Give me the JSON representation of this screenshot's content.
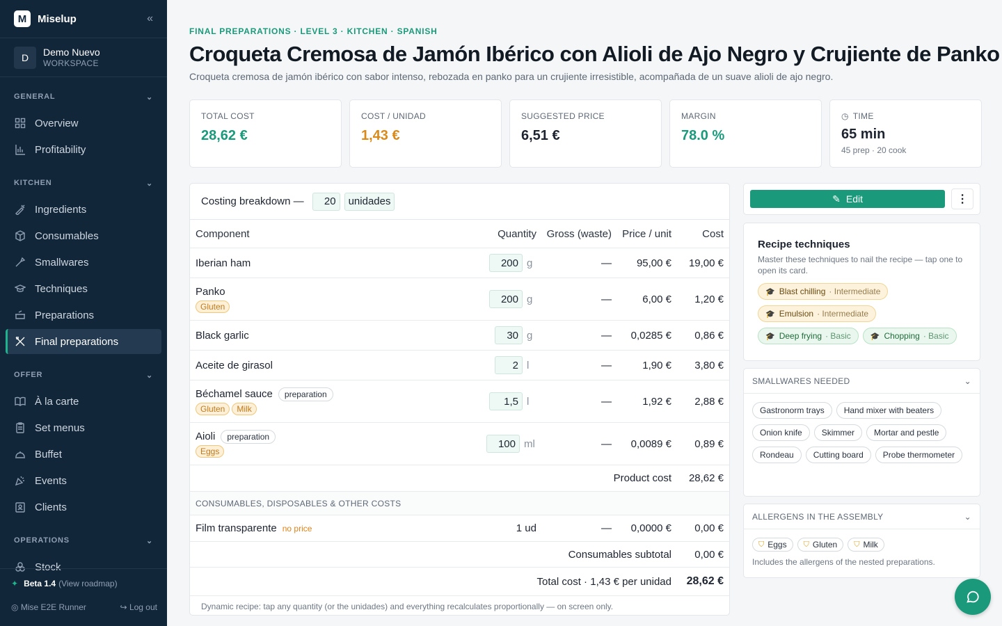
{
  "app": {
    "name": "Miselup",
    "logo_letter": "M"
  },
  "workspace": {
    "avatar": "D",
    "name": "Demo Nuevo",
    "label": "WORKSPACE"
  },
  "nav": {
    "general": {
      "title": "GENERAL",
      "items": [
        {
          "label": "Overview",
          "icon": "grid-icon"
        },
        {
          "label": "Profitability",
          "icon": "bar-chart-icon"
        }
      ]
    },
    "kitchen": {
      "title": "KITCHEN",
      "items": [
        {
          "label": "Ingredients",
          "icon": "carrot-icon"
        },
        {
          "label": "Consumables",
          "icon": "box-icon"
        },
        {
          "label": "Smallwares",
          "icon": "tool-icon"
        },
        {
          "label": "Techniques",
          "icon": "graduation-cap-icon"
        },
        {
          "label": "Preparations",
          "icon": "pot-icon"
        },
        {
          "label": "Final preparations",
          "icon": "utensils-icon",
          "active": true
        }
      ]
    },
    "offer": {
      "title": "OFFER",
      "items": [
        {
          "label": "À la carte",
          "icon": "book-icon"
        },
        {
          "label": "Set menus",
          "icon": "clipboard-icon"
        },
        {
          "label": "Buffet",
          "icon": "cloche-icon"
        },
        {
          "label": "Events",
          "icon": "party-icon"
        },
        {
          "label": "Clients",
          "icon": "id-card-icon"
        }
      ]
    },
    "operations": {
      "title": "OPERATIONS",
      "items": [
        {
          "label": "Stock",
          "icon": "boxes-icon"
        }
      ]
    }
  },
  "sidebar_footer": {
    "version": "Beta 1.4",
    "roadmap": "(View roadmap)",
    "user": "Mise E2E Runner",
    "logout": "Log out"
  },
  "recipe": {
    "eyebrow": "FINAL PREPARATIONS  · LEVEL 3 · KITCHEN · SPANISH",
    "title": "Croqueta Cremosa de Jamón Ibérico con Alioli de Ajo Negro y Crujiente de Panko",
    "description": "Croqueta cremosa de jamón ibérico con sabor intenso, rebozada en panko para un crujiente irresistible, acompañada de un suave alioli de ajo negro."
  },
  "stats": {
    "total_cost": {
      "label": "TOTAL COST",
      "value": "28,62 €",
      "color": "#1a9a7b"
    },
    "cost_unit": {
      "label": "COST / UNIDAD",
      "value": "1,43 €",
      "color": "#d98a1a"
    },
    "suggested_price": {
      "label": "SUGGESTED PRICE",
      "value": "6,51 €",
      "color": "#1d2430"
    },
    "margin": {
      "label": "MARGIN",
      "value": "78.0 %",
      "color": "#1a9a7b"
    },
    "time": {
      "label": "TIME",
      "value": "65 min",
      "sub": "45 prep · 20 cook"
    }
  },
  "costing": {
    "heading": "Costing breakdown —",
    "yield_qty": "20",
    "yield_unit": "unidades",
    "columns": {
      "component": "Component",
      "quantity": "Quantity",
      "gross": "Gross (waste)",
      "price": "Price / unit",
      "cost": "Cost"
    },
    "rows": [
      {
        "name": "Iberian ham",
        "qty": "200",
        "unit": "g",
        "gross": "—",
        "price": "95,00 €",
        "cost": "19,00 €"
      },
      {
        "name": "Panko",
        "allergens": [
          "Gluten"
        ],
        "qty": "200",
        "unit": "g",
        "gross": "—",
        "price": "6,00 €",
        "cost": "1,20 €"
      },
      {
        "name": "Black garlic",
        "qty": "30",
        "unit": "g",
        "gross": "—",
        "price": "0,0285 €",
        "cost": "0,86 €"
      },
      {
        "name": "Aceite de girasol",
        "qty": "2",
        "unit": "l",
        "gross": "—",
        "price": "1,90 €",
        "cost": "3,80 €"
      },
      {
        "name": "Béchamel sauce",
        "tag": "preparation",
        "allergens": [
          "Gluten",
          "Milk"
        ],
        "qty": "1,5",
        "unit": "l",
        "gross": "—",
        "price": "1,92 €",
        "cost": "2,88 €"
      },
      {
        "name": "Aioli",
        "tag": "preparation",
        "allergens": [
          "Eggs"
        ],
        "qty": "100",
        "unit": "ml",
        "gross": "—",
        "price": "0,0089 €",
        "cost": "0,89 €"
      }
    ],
    "product_cost_label": "Product cost",
    "product_cost": "28,62 €",
    "consumables_heading": "CONSUMABLES, DISPOSABLES & OTHER COSTS",
    "consumables": [
      {
        "name": "Film transparente",
        "flag": "no price",
        "qty": "1 ud",
        "gross": "—",
        "price": "0,0000 €",
        "cost": "0,00 €"
      }
    ],
    "consumables_subtotal_label": "Consumables subtotal",
    "consumables_subtotal": "0,00 €",
    "total_label": "Total cost · 1,43 € per unidad",
    "total": "28,62 €",
    "note": "Dynamic recipe: tap any quantity (or the unidades) and everything recalculates proportionally — on screen only."
  },
  "actions": {
    "edit": "Edit",
    "more": "⋮"
  },
  "techniques": {
    "title": "Recipe techniques",
    "description": "Master these techniques to nail the recipe — tap one to open its card.",
    "items": [
      {
        "name": "Blast chilling",
        "level": "· Intermediate",
        "kind": "inter"
      },
      {
        "name": "Emulsion",
        "level": "· Intermediate",
        "kind": "inter"
      },
      {
        "name": "Deep frying",
        "level": "· Basic",
        "kind": "basic"
      },
      {
        "name": "Chopping",
        "level": "· Basic",
        "kind": "basic"
      }
    ]
  },
  "smallwares": {
    "title": "SMALLWARES NEEDED",
    "items": [
      "Gastronorm trays",
      "Hand mixer with beaters",
      "Onion knife",
      "Skimmer",
      "Mortar and pestle",
      "Rondeau",
      "Cutting board",
      "Probe thermometer"
    ]
  },
  "allergens": {
    "title": "ALLERGENS IN THE ASSEMBLY",
    "items": [
      "Eggs",
      "Gluten",
      "Milk"
    ],
    "note": "Includes the allergens of the nested preparations."
  }
}
